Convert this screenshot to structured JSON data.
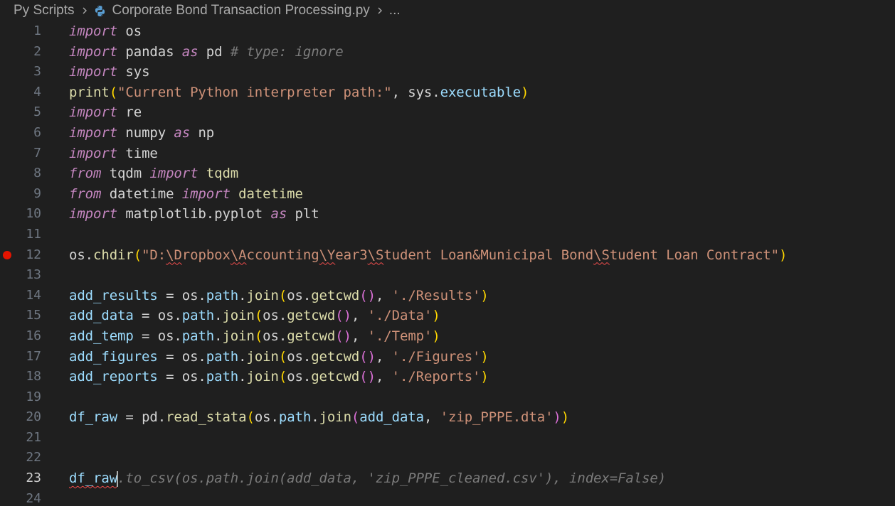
{
  "breadcrumb": {
    "folder": "Py Scripts",
    "file": "Corporate Bond Transaction Processing.py",
    "more": "..."
  },
  "gutter": {
    "breakpoint_line": 12,
    "active_line": 23
  },
  "lines": [
    [
      [
        "import",
        "kw"
      ],
      [
        " os",
        "w"
      ]
    ],
    [
      [
        "import",
        "kw"
      ],
      [
        " pandas ",
        "w"
      ],
      [
        "as",
        "kw"
      ],
      [
        " pd ",
        "w"
      ],
      [
        "# type: ignore",
        "cm"
      ]
    ],
    [
      [
        "import",
        "kw"
      ],
      [
        " sys",
        "w"
      ]
    ],
    [
      [
        "print",
        "f"
      ],
      [
        "(",
        "p1"
      ],
      [
        "\"Current Python interpreter path:\"",
        "s"
      ],
      [
        ", sys.",
        "w"
      ],
      [
        "executable",
        "v"
      ],
      [
        ")",
        "p1"
      ]
    ],
    [
      [
        "import",
        "kw"
      ],
      [
        " re",
        "w"
      ]
    ],
    [
      [
        "import",
        "kw"
      ],
      [
        " numpy ",
        "w"
      ],
      [
        "as",
        "kw"
      ],
      [
        " np",
        "w"
      ]
    ],
    [
      [
        "import",
        "kw"
      ],
      [
        " time",
        "w"
      ]
    ],
    [
      [
        "from",
        "kw"
      ],
      [
        " tqdm ",
        "w"
      ],
      [
        "import",
        "kw"
      ],
      [
        " tqdm",
        "f"
      ]
    ],
    [
      [
        "from",
        "kw"
      ],
      [
        " datetime ",
        "w"
      ],
      [
        "import",
        "kw"
      ],
      [
        " datetime",
        "f"
      ]
    ],
    [
      [
        "import",
        "kw"
      ],
      [
        " matplotlib.pyplot ",
        "w"
      ],
      [
        "as",
        "kw"
      ],
      [
        " plt",
        "w"
      ]
    ],
    [],
    [
      [
        "os.",
        "w"
      ],
      [
        "chdir",
        "f"
      ],
      [
        "(",
        "p1"
      ],
      [
        "\"D:",
        "s"
      ],
      [
        "\\D",
        "s squig"
      ],
      [
        "ropbox",
        "s"
      ],
      [
        "\\A",
        "s squig"
      ],
      [
        "ccounting",
        "s"
      ],
      [
        "\\Y",
        "s squig"
      ],
      [
        "ear3",
        "s"
      ],
      [
        "\\S",
        "s squig"
      ],
      [
        "tudent Loan&Municipal Bond",
        "s"
      ],
      [
        "\\S",
        "s squig"
      ],
      [
        "tudent Loan Contract\"",
        "s"
      ],
      [
        ")",
        "p1"
      ]
    ],
    [],
    [
      [
        "add_results",
        "v"
      ],
      [
        " = os.",
        "w"
      ],
      [
        "path",
        "v"
      ],
      [
        ".",
        "w"
      ],
      [
        "join",
        "f"
      ],
      [
        "(",
        "p1"
      ],
      [
        "os.",
        "w"
      ],
      [
        "getcwd",
        "f"
      ],
      [
        "()",
        "p2"
      ],
      [
        ", ",
        "w"
      ],
      [
        "'./Results'",
        "s"
      ],
      [
        ")",
        "p1"
      ]
    ],
    [
      [
        "add_data",
        "v"
      ],
      [
        " = os.",
        "w"
      ],
      [
        "path",
        "v"
      ],
      [
        ".",
        "w"
      ],
      [
        "join",
        "f"
      ],
      [
        "(",
        "p1"
      ],
      [
        "os.",
        "w"
      ],
      [
        "getcwd",
        "f"
      ],
      [
        "()",
        "p2"
      ],
      [
        ", ",
        "w"
      ],
      [
        "'./Data'",
        "s"
      ],
      [
        ")",
        "p1"
      ]
    ],
    [
      [
        "add_temp",
        "v"
      ],
      [
        " = os.",
        "w"
      ],
      [
        "path",
        "v"
      ],
      [
        ".",
        "w"
      ],
      [
        "join",
        "f"
      ],
      [
        "(",
        "p1"
      ],
      [
        "os.",
        "w"
      ],
      [
        "getcwd",
        "f"
      ],
      [
        "()",
        "p2"
      ],
      [
        ", ",
        "w"
      ],
      [
        "'./Temp'",
        "s"
      ],
      [
        ")",
        "p1"
      ]
    ],
    [
      [
        "add_figures",
        "v"
      ],
      [
        " = os.",
        "w"
      ],
      [
        "path",
        "v"
      ],
      [
        ".",
        "w"
      ],
      [
        "join",
        "f"
      ],
      [
        "(",
        "p1"
      ],
      [
        "os.",
        "w"
      ],
      [
        "getcwd",
        "f"
      ],
      [
        "()",
        "p2"
      ],
      [
        ", ",
        "w"
      ],
      [
        "'./Figures'",
        "s"
      ],
      [
        ")",
        "p1"
      ]
    ],
    [
      [
        "add_reports",
        "v"
      ],
      [
        " = os.",
        "w"
      ],
      [
        "path",
        "v"
      ],
      [
        ".",
        "w"
      ],
      [
        "join",
        "f"
      ],
      [
        "(",
        "p1"
      ],
      [
        "os.",
        "w"
      ],
      [
        "getcwd",
        "f"
      ],
      [
        "()",
        "p2"
      ],
      [
        ", ",
        "w"
      ],
      [
        "'./Reports'",
        "s"
      ],
      [
        ")",
        "p1"
      ]
    ],
    [],
    [
      [
        "df_raw",
        "v"
      ],
      [
        " = pd.",
        "w"
      ],
      [
        "read_stata",
        "f"
      ],
      [
        "(",
        "p1"
      ],
      [
        "os.",
        "w"
      ],
      [
        "path",
        "v"
      ],
      [
        ".",
        "w"
      ],
      [
        "join",
        "f"
      ],
      [
        "(",
        "p2"
      ],
      [
        "add_data",
        "v"
      ],
      [
        ", ",
        "w"
      ],
      [
        "'zip_PPPE.dta'",
        "s"
      ],
      [
        ")",
        "p2"
      ],
      [
        ")",
        "p1"
      ]
    ],
    [],
    [],
    [
      [
        "df_raw",
        "v squig"
      ],
      [
        "|",
        "cursor"
      ],
      [
        ".to_csv(os.path.join(add_data, 'zip_PPPE_cleaned.csv'), index=False)",
        "ghost"
      ]
    ],
    []
  ]
}
